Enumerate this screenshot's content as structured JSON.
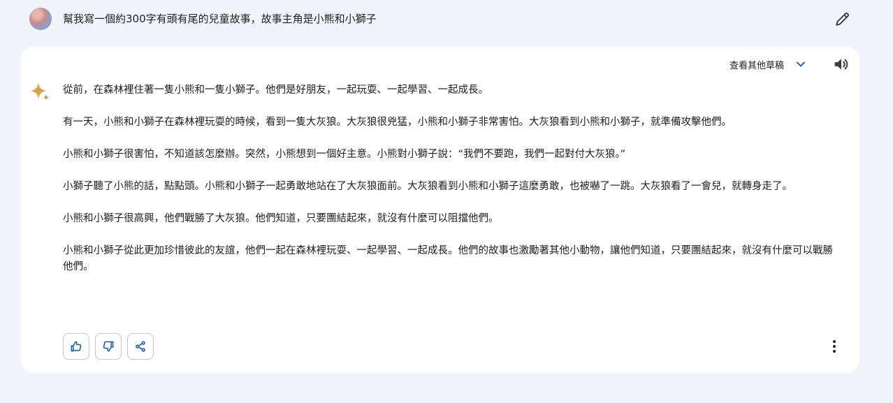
{
  "prompt": {
    "text": "幫我寫一個約300字有頭有尾的兒童故事，故事主角是小熊和小獅子",
    "avatar_icon": "user-avatar",
    "edit_icon": "pencil-icon"
  },
  "response": {
    "drafts_label": "查看其他草稿",
    "drafts_icon": "chevron-down-icon",
    "speaker_icon": "volume-icon",
    "assistant_icon": "sparkle-icon",
    "paragraphs": [
      "從前，在森林裡住著一隻小熊和一隻小獅子。他們是好朋友，一起玩耍、一起學習、一起成長。",
      "有一天，小熊和小獅子在森林裡玩耍的時候，看到一隻大灰狼。大灰狼很兇猛，小熊和小獅子非常害怕。大灰狼看到小熊和小獅子，就準備攻擊他們。",
      "小熊和小獅子很害怕，不知道該怎麼辦。突然，小熊想到一個好主意。小熊對小獅子說：“我們不要跑，我們一起對付大灰狼。”",
      "小獅子聽了小熊的話，點點頭。小熊和小獅子一起勇敢地站在了大灰狼面前。大灰狼看到小熊和小獅子這麼勇敢，也被嚇了一跳。大灰狼看了一會兒，就轉身走了。",
      "小熊和小獅子很高興，他們戰勝了大灰狼。他們知道，只要團結起來，就沒有什麼可以阻擋他們。",
      "小熊和小獅子從此更加珍惜彼此的友誼，他們一起在森林裡玩耍、一起學習、一起成長。他們的故事也激勵著其他小動物，讓他們知道，只要團結起來，就沒有什麼可以戰勝他們。"
    ],
    "action_icons": [
      "thumbs-up-icon",
      "thumbs-down-icon",
      "share-icon",
      "more-vert-icon"
    ]
  },
  "colors": {
    "page_bg": "#f1f4fc",
    "card_bg": "#ffffff",
    "accent_blue": "#0b57d0",
    "sparkle_gold": "#c99a3b"
  }
}
